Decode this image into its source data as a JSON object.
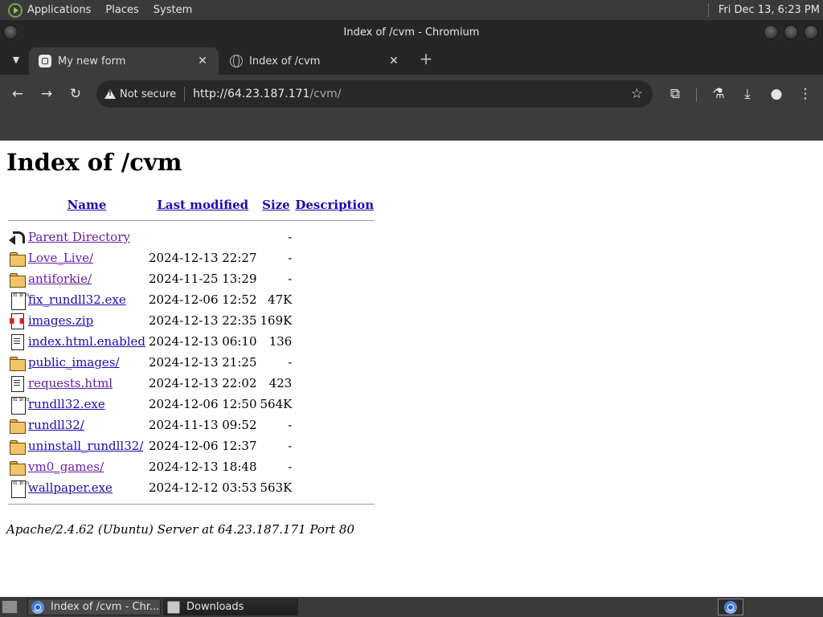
{
  "top_panel": {
    "menus": [
      "Applications",
      "Places",
      "System"
    ],
    "clock": "Fri Dec 13,  6:23 PM"
  },
  "window": {
    "title": "Index of /cvm - Chromium"
  },
  "tabs": [
    {
      "title": "My new form",
      "active": true
    },
    {
      "title": "Index of /cvm",
      "active": false
    }
  ],
  "omnibox": {
    "security_label": "Not secure",
    "url_host": "http://64.23.187.171",
    "url_path": "/cvm/"
  },
  "page": {
    "heading": "Index of /cvm",
    "columns": {
      "name": "Name",
      "modified": "Last modified",
      "size": "Size",
      "description": "Description"
    },
    "rows": [
      {
        "icon": "back-icon",
        "name": "Parent Directory",
        "modified": "",
        "size": "-",
        "visited": true
      },
      {
        "icon": "folder-icon",
        "name": "Love_Live/",
        "modified": "2024-12-13 22:27",
        "size": "-",
        "visited": true
      },
      {
        "icon": "folder-icon",
        "name": "antiforkie/",
        "modified": "2024-11-25 13:29",
        "size": "-",
        "visited": true
      },
      {
        "icon": "binary-icon",
        "name": "fix_rundll32.exe",
        "modified": "2024-12-06 12:52",
        "size": "47K",
        "visited": false
      },
      {
        "icon": "zip-icon",
        "name": "images.zip",
        "modified": "2024-12-13 22:35",
        "size": "169K",
        "visited": false
      },
      {
        "icon": "text-icon",
        "name": "index.html.enabled",
        "modified": "2024-12-13 06:10",
        "size": "136",
        "visited": false
      },
      {
        "icon": "folder-icon",
        "name": "public_images/",
        "modified": "2024-12-13 21:25",
        "size": "-",
        "visited": false
      },
      {
        "icon": "text-icon",
        "name": "requests.html",
        "modified": "2024-12-13 22:02",
        "size": "423",
        "visited": true
      },
      {
        "icon": "binary-icon",
        "name": "rundll32.exe",
        "modified": "2024-12-06 12:50",
        "size": "564K",
        "visited": false
      },
      {
        "icon": "folder-icon",
        "name": "rundll32/",
        "modified": "2024-11-13 09:52",
        "size": "-",
        "visited": false
      },
      {
        "icon": "folder-icon",
        "name": "uninstall_rundll32/",
        "modified": "2024-12-06 12:37",
        "size": "-",
        "visited": false
      },
      {
        "icon": "folder-icon",
        "name": "vm0_games/",
        "modified": "2024-12-13 18:48",
        "size": "-",
        "visited": true
      },
      {
        "icon": "binary-icon",
        "name": "wallpaper.exe",
        "modified": "2024-12-12 03:53",
        "size": "563K",
        "visited": false
      }
    ],
    "footer": "Apache/2.4.62 (Ubuntu) Server at 64.23.187.171 Port 80"
  },
  "taskbar": {
    "tasks": [
      "Index of /cvm - Chr...",
      "Downloads"
    ]
  },
  "colors": {
    "link": "#1a0dab",
    "visited": "#681da8",
    "chrome_dark": "#3c3c3c",
    "panel": "#3a3a3a"
  }
}
